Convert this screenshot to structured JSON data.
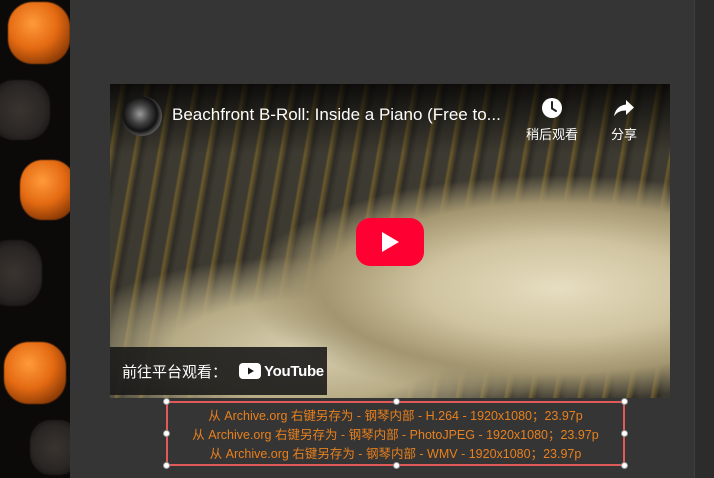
{
  "video": {
    "title": "Beachfront B-Roll: Inside a Piano (Free to...",
    "watch_later_label": "稍后观看",
    "share_label": "分享",
    "watch_on_label": "前往平台观看：",
    "platform_name": "YouTube",
    "play_button_color": "#ff0033"
  },
  "download_links": [
    {
      "text": "从 Archive.org 右键另存为 - 钢琴内部 - H.264 - 1920x1080；23.97p"
    },
    {
      "text": "从 Archive.org 右键另存为 - 钢琴内部 - PhotoJPEG - 1920x1080；23.97p"
    },
    {
      "text": "从 Archive.org 右键另存为 - 钢琴内部 - WMV - 1920x1080；23.97p"
    }
  ],
  "colors": {
    "link": "#e8801e",
    "selection_border": "#e05a5a",
    "background": "#353535"
  }
}
